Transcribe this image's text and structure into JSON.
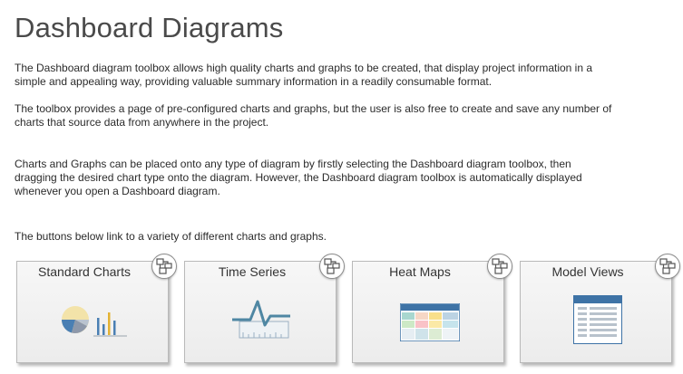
{
  "page": {
    "title": "Dashboard Diagrams",
    "paragraphs": [
      "The Dashboard diagram toolbox allows high quality charts and graphs to be created, that display project information in a simple and appealing way, providing valuable summary information in a readily consumable format.",
      "The toolbox provides a page of pre-configured charts and graphs, but the user is also free to create and save any number of charts that source data from anywhere in the project.",
      "Charts and Graphs can be placed onto any type of diagram by firstly selecting the Dashboard diagram toolbox, then dragging the desired chart type onto the diagram.  However, the Dashboard diagram toolbox is automatically displayed whenever you open a Dashboard diagram.",
      "The buttons below link to a variety of different charts and graphs."
    ]
  },
  "cards": [
    {
      "label": "Standard Charts",
      "icon": "standard-charts-icon",
      "badge_icon": "diagram-link-icon"
    },
    {
      "label": "Time Series",
      "icon": "time-series-icon",
      "badge_icon": "diagram-link-icon"
    },
    {
      "label": "Heat Maps",
      "icon": "heat-map-icon",
      "badge_icon": "diagram-link-icon"
    },
    {
      "label": "Model Views",
      "icon": "model-views-icon",
      "badge_icon": "diagram-link-icon"
    }
  ],
  "colors": {
    "accent_blue": "#3e73a6",
    "icon_teal": "#4f87a3"
  }
}
